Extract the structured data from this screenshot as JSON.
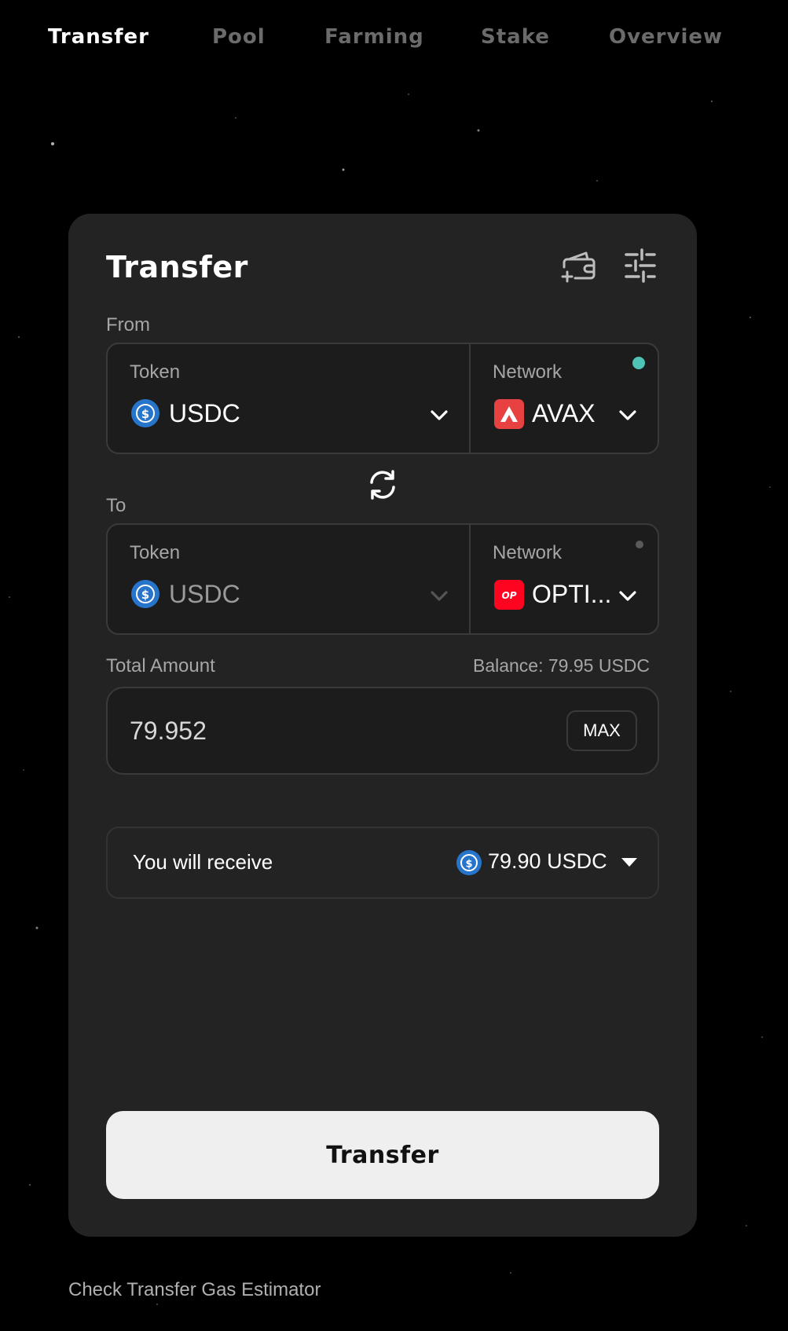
{
  "nav": {
    "items": [
      {
        "label": "Transfer",
        "active": true
      },
      {
        "label": "Pool",
        "active": false
      },
      {
        "label": "Farming",
        "active": false
      },
      {
        "label": "Stake",
        "active": false
      },
      {
        "label": "Overview",
        "active": false
      }
    ]
  },
  "card": {
    "title": "Transfer",
    "icons": {
      "wallet": "wallet-add-icon",
      "settings": "sliders-icon"
    },
    "from": {
      "label": "From",
      "token_label": "Token",
      "token": "USDC",
      "network_label": "Network",
      "network": "AVAX",
      "status_color": "#4fc3b5"
    },
    "to": {
      "label": "To",
      "token_label": "Token",
      "token": "USDC",
      "network_label": "Network",
      "network": "OPTI...",
      "status_color": "#5a5a5a"
    },
    "amount": {
      "label": "Total Amount",
      "balance": "Balance: 79.95 USDC",
      "value": "79.952",
      "max_label": "MAX"
    },
    "receive": {
      "label": "You will receive",
      "value": "79.90 USDC"
    },
    "submit_label": "Transfer"
  },
  "footer": {
    "link": "Check Transfer Gas Estimator"
  },
  "colors": {
    "background": "#000000",
    "card": "#232323",
    "usdc": "#2775ca",
    "avax": "#e84142",
    "optimism": "#ff0420"
  }
}
